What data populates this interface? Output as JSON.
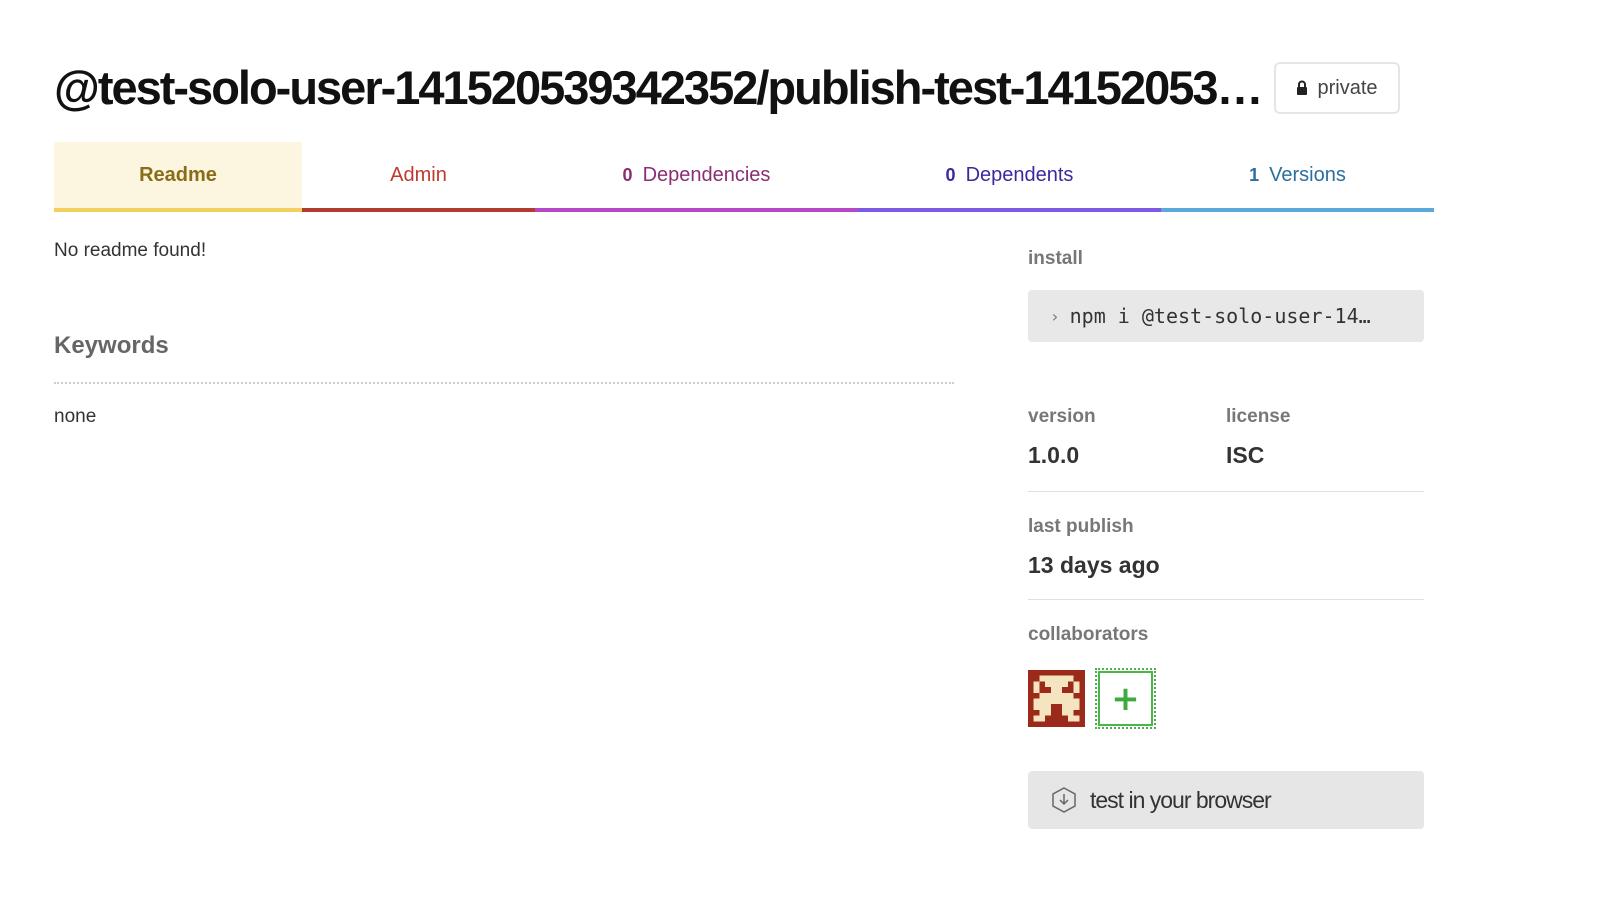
{
  "package": {
    "title": "@test-solo-user-141520539342352/publish-test-14152053…",
    "visibility": "private"
  },
  "tabs": [
    {
      "label": "Readme",
      "count": ""
    },
    {
      "label": "Admin",
      "count": ""
    },
    {
      "label": "Dependencies",
      "count": "0"
    },
    {
      "label": "Dependents",
      "count": "0"
    },
    {
      "label": "Versions",
      "count": "1"
    }
  ],
  "readme": {
    "message": "No readme found!"
  },
  "keywords": {
    "heading": "Keywords",
    "value": "none"
  },
  "sidebar": {
    "install_label": "install",
    "install_command": "npm i @test-solo-user-14…",
    "version_label": "version",
    "version_value": "1.0.0",
    "license_label": "license",
    "license_value": "ISC",
    "last_publish_label": "last publish",
    "last_publish_value": "13 days ago",
    "collaborators_label": "collaborators",
    "add_collaborator": "+",
    "browser_button": "test in your browser"
  },
  "icons": {
    "lock": "lock-icon",
    "prompt": "prompt-icon",
    "avatar": "avatar",
    "browser": "download-hex-icon"
  },
  "colors": {
    "readme": "#f2d060",
    "admin": "#b33a2f",
    "dependencies": "#b548c6",
    "dependents": "#7d5ae2",
    "versions": "#5ba9d9",
    "add_collaborator": "#4ab54a",
    "avatar_bg": "#9b2a1a",
    "avatar_fg": "#f4e4c0"
  }
}
